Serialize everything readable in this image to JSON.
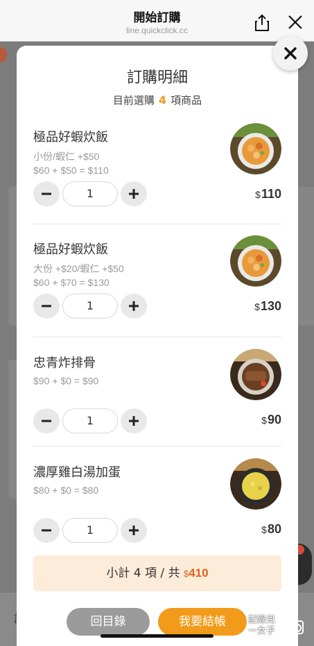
{
  "browser": {
    "title": "開始訂購",
    "url": "line.quickclick.cc",
    "share_icon": "share-icon",
    "close_icon": "close-icon"
  },
  "background": {
    "bottom_text": "訂"
  },
  "modal": {
    "title": "訂購明細",
    "subtitle_prefix": "目前選購",
    "subtitle_count": "4",
    "subtitle_suffix": "項商品",
    "items": [
      {
        "name": "極品好蝦炊飯",
        "option": "小份/蝦仁 +$50",
        "formula": "$60 + $50 = $110",
        "quantity": "1",
        "currency": "$",
        "price": "110"
      },
      {
        "name": "極品好蝦炊飯",
        "option": "大份 +$20/蝦仁 +$50",
        "formula": "$60 + $70 = $130",
        "quantity": "1",
        "currency": "$",
        "price": "130"
      },
      {
        "name": "忠青炸排骨",
        "option": "",
        "formula": "$90 + $0 = $90",
        "quantity": "1",
        "currency": "$",
        "price": "90"
      },
      {
        "name": "濃厚雞白湯加蛋",
        "option": "",
        "formula": "$80 + $0 = $80",
        "quantity": "1",
        "currency": "$",
        "price": "80"
      }
    ],
    "subtotal": {
      "label": "小計 4 項 / 共",
      "currency": "$",
      "amount": "410"
    },
    "back_label": "回目錄",
    "checkout_label": "我要結帳"
  },
  "watermark": {
    "line1": "記錄兒",
    "line2": "一女子"
  },
  "colors": {
    "accent": "#f29b1a",
    "price_highlight": "#e0621f",
    "subtotal_bg": "#fdecd9"
  }
}
